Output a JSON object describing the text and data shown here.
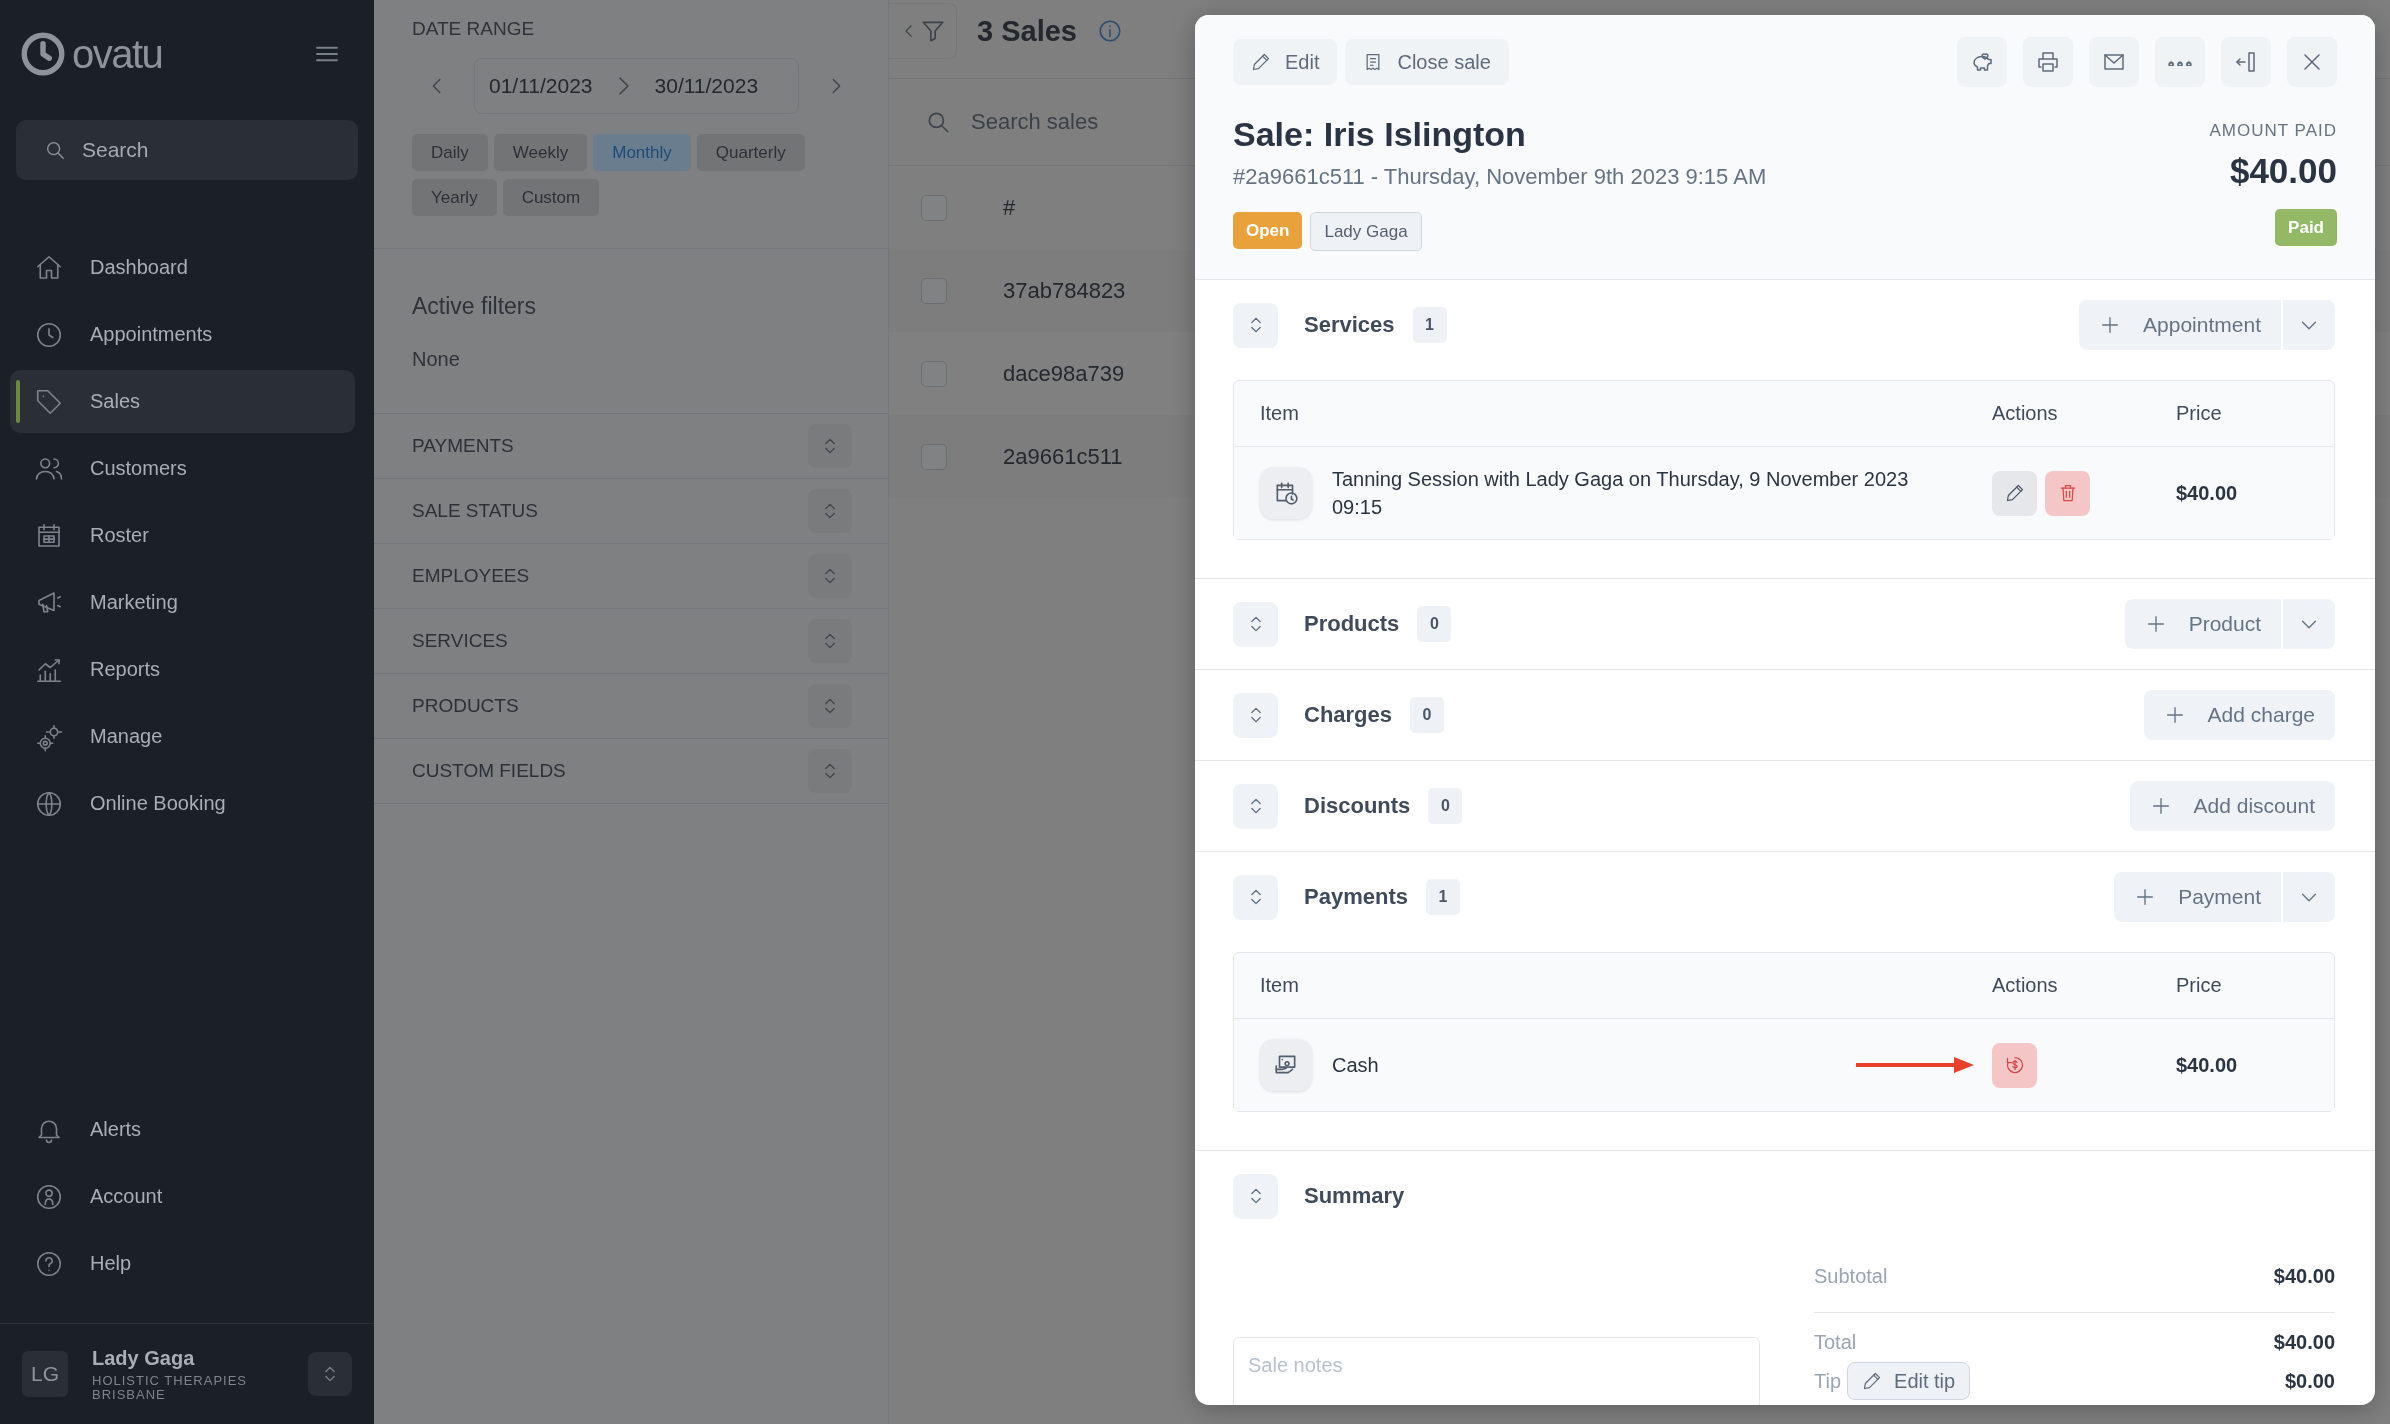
{
  "sidebar": {
    "logo": "ovatu",
    "search": {
      "placeholder": "Search"
    },
    "nav_items": [
      {
        "label": "Dashboard",
        "selected": false
      },
      {
        "label": "Appointments",
        "selected": false
      },
      {
        "label": "Sales",
        "selected": true
      },
      {
        "label": "Customers",
        "selected": false
      },
      {
        "label": "Roster",
        "selected": false
      },
      {
        "label": "Marketing",
        "selected": false
      },
      {
        "label": "Reports",
        "selected": false
      },
      {
        "label": "Manage",
        "selected": false
      },
      {
        "label": "Online Booking",
        "selected": false
      }
    ],
    "bottom_items": [
      {
        "label": "Alerts"
      },
      {
        "label": "Account"
      },
      {
        "label": "Help"
      }
    ],
    "user": {
      "initials": "LG",
      "name": "Lady Gaga",
      "business": "HOLISTIC THERAPIES BRISBANE"
    }
  },
  "filters": {
    "date_range_label": "DATE RANGE",
    "start_date": "01/11/2023",
    "end_date": "30/11/2023",
    "periods": [
      {
        "label": "Daily",
        "selected": false
      },
      {
        "label": "Weekly",
        "selected": false
      },
      {
        "label": "Monthly",
        "selected": true
      },
      {
        "label": "Quarterly",
        "selected": false
      },
      {
        "label": "Yearly",
        "selected": false
      },
      {
        "label": "Custom",
        "selected": false
      }
    ],
    "active_filters_title": "Active filters",
    "active_filters_value": "None",
    "groups": [
      "PAYMENTS",
      "SALE STATUS",
      "EMPLOYEES",
      "SERVICES",
      "PRODUCTS",
      "CUSTOM FIELDS"
    ]
  },
  "sales_list": {
    "title": "3 Sales",
    "search": {
      "placeholder": "Search sales"
    },
    "column_header": "#",
    "header_checked": false,
    "rows": [
      {
        "id": "37ab784823",
        "checked": false
      },
      {
        "id": "dace98a739",
        "checked": false
      },
      {
        "id": "2a9661c511",
        "checked": false
      }
    ]
  },
  "sale_drawer": {
    "toolbar": [
      "Edit",
      "Close sale"
    ],
    "title": "Sale: Iris Islington",
    "subtitle": "#2a9661c511 - Thursday, November 9th 2023 9:15 AM",
    "tags": [
      {
        "label": "Open",
        "kind": "status"
      },
      {
        "label": "Lady Gaga",
        "kind": "staff"
      }
    ],
    "amount_label": "AMOUNT PAID",
    "amount": "$40.00",
    "payment_status": "Paid",
    "sections": [
      {
        "title": "Services",
        "count": "1",
        "add_label": "Appointment",
        "has_dropdown": true,
        "table": {
          "columns": [
            "Item",
            "Actions",
            "Price"
          ],
          "rows": [
            {
              "kind": "service",
              "item": "Tanning Session with Lady Gaga on Thursday, 9 November 2023 09:15",
              "price": "$40.00",
              "highlighted": false
            }
          ]
        }
      },
      {
        "title": "Products",
        "count": "0",
        "add_label": "Product",
        "has_dropdown": true
      },
      {
        "title": "Charges",
        "count": "0",
        "add_label": "Add charge",
        "has_dropdown": false
      },
      {
        "title": "Discounts",
        "count": "0",
        "add_label": "Add discount",
        "has_dropdown": false
      },
      {
        "title": "Payments",
        "count": "1",
        "add_label": "Payment",
        "has_dropdown": true,
        "table": {
          "columns": [
            "Item",
            "Actions",
            "Price"
          ],
          "rows": [
            {
              "kind": "payment",
              "item": "Cash",
              "price": "$40.00",
              "highlighted": true
            }
          ]
        }
      }
    ],
    "summary": {
      "title": "Summary",
      "notes_placeholder": "Sale notes",
      "subtotal_label": "Subtotal",
      "subtotal": "$40.00",
      "total_label": "Total",
      "total": "$40.00",
      "tip_label": "Tip",
      "tip_button": "Edit tip",
      "tip": "$0.00"
    }
  }
}
